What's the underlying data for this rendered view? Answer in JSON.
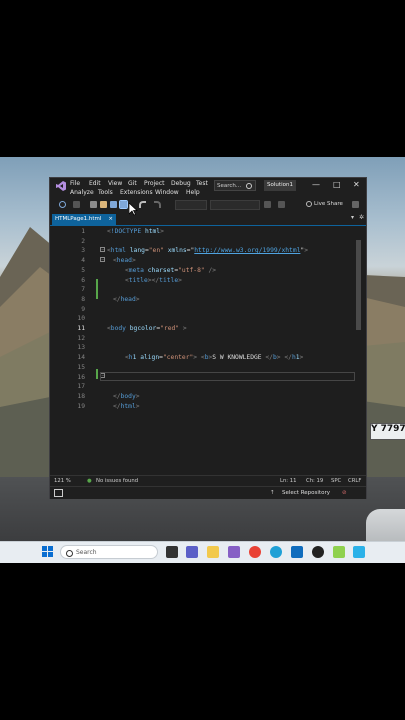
{
  "menu": {
    "items": [
      "File",
      "Edit",
      "View",
      "Git",
      "Project",
      "Debug",
      "Test",
      "Analyze",
      "Tools",
      "Extensions",
      "Window",
      "Help"
    ]
  },
  "search": {
    "label": "Search..."
  },
  "solution": {
    "label": "Solution1"
  },
  "window_controls": {
    "minimize": "—",
    "maximize": "□",
    "close": "✕"
  },
  "toolbar": {
    "live_share": "Live Share"
  },
  "tab": {
    "name": "HTMLPage1.html",
    "close": "×"
  },
  "editor": {
    "current_line": "11",
    "lines": [
      {
        "n": "1",
        "text": "<!DOCTYPE html>"
      },
      {
        "n": "2",
        "text": ""
      },
      {
        "n": "3",
        "text": "<html lang=\"en\" xmlns=\"http://www.w3.org/1999/xhtml\">"
      },
      {
        "n": "4",
        "text": "<head>"
      },
      {
        "n": "5",
        "text": "<meta charset=\"utf-8\" />"
      },
      {
        "n": "6",
        "text": "<title></title>"
      },
      {
        "n": "7",
        "text": ""
      },
      {
        "n": "8",
        "text": "</head>"
      },
      {
        "n": "9",
        "text": ""
      },
      {
        "n": "10",
        "text": ""
      },
      {
        "n": "11",
        "text": "<body bgcolor=\"red\" >"
      },
      {
        "n": "12",
        "text": ""
      },
      {
        "n": "13",
        "text": ""
      },
      {
        "n": "14",
        "text": "<h1 align=\"center\"> <b>S W KNOWLEDGE </b> </h1>"
      },
      {
        "n": "15",
        "text": ""
      },
      {
        "n": "16",
        "text": ""
      },
      {
        "n": "17",
        "text": ""
      },
      {
        "n": "18",
        "text": "</body>"
      },
      {
        "n": "19",
        "text": "</html>"
      }
    ]
  },
  "status": {
    "zoom": "121 %",
    "issues": "No issues found",
    "line": "Ln: 11",
    "col": "Ch: 19",
    "spc": "SPC",
    "eol": "CRLF",
    "select_repo": "Select Repository"
  },
  "taskbar": {
    "search": "Search"
  },
  "wallpaper": {
    "plate": "Y 7797"
  },
  "colors": {
    "accent": "#0e639c",
    "vs_purple": "#865fc5",
    "change_bar": "#57a64a"
  }
}
